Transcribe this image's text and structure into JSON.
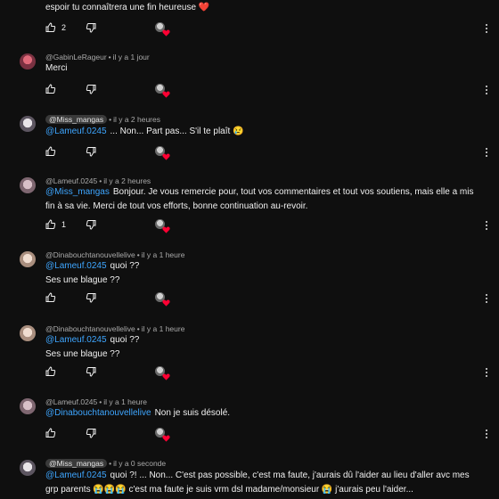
{
  "top": {
    "text": "espoir tu connaîtrera une fin heureuse ❤️",
    "like_count": "2"
  },
  "comments": [
    {
      "author": "@GabinLeRageur",
      "time": "il y a 1 jour",
      "mention": "",
      "text": "Merci",
      "like_count": ""
    },
    {
      "author": "@Miss_mangas",
      "time": "il y a 2 heures",
      "mention": "@Lameuf.0245",
      "text": "... Non... Part pas... S'il te plaît 😢",
      "like_count": ""
    },
    {
      "author": "@Lameuf.0245",
      "time": "il y a 2 heures",
      "mention": "@Miss_mangas",
      "text": "Bonjour. Je vous remercie pour, tout vos commentaires et tout vos soutiens, mais elle a mis fin à sa vie. Merci de tout vos efforts, bonne continuation au-revoir.",
      "like_count": "1"
    },
    {
      "author": "@Dinabouchtanouvellelive",
      "time": "il y a 1 heure",
      "mention": "@Lameuf.0245",
      "text": "quoi ??",
      "text2": "Ses une blague ??",
      "like_count": ""
    },
    {
      "author": "@Dinabouchtanouvellelive",
      "time": "il y a 1 heure",
      "mention": "@Lameuf.0245",
      "text": "quoi ??",
      "text2": "Ses une blague ??",
      "like_count": ""
    },
    {
      "author": "@Lameuf.0245",
      "time": "il y a 1 heure",
      "mention": "@Dinabouchtanouvellelive",
      "text": "Non je suis désolé.",
      "like_count": ""
    },
    {
      "author": "@Miss_mangas",
      "time": "il y a 0 seconde",
      "mention": "@Lameuf.0245",
      "text": "quoi ?! ... Non... C'est pas possible, c'est ma faute, j'aurais dû l'aider au lieu d'aller avc mes grp parents 😭😭😭 c'est ma faute je suis vrm dsl madame/monsieur 😭 j'aurais peu l'aider...",
      "like_count": ""
    }
  ],
  "icons": {
    "like": "thumb-up-icon",
    "dislike": "thumb-down-icon",
    "heart": "creator-heart-icon",
    "more": "more-vertical-icon"
  },
  "colors": {
    "background": "#0f0f0f",
    "mention": "#3ea6ff",
    "heart": "#ff0033",
    "meta": "#aaaaaa"
  }
}
